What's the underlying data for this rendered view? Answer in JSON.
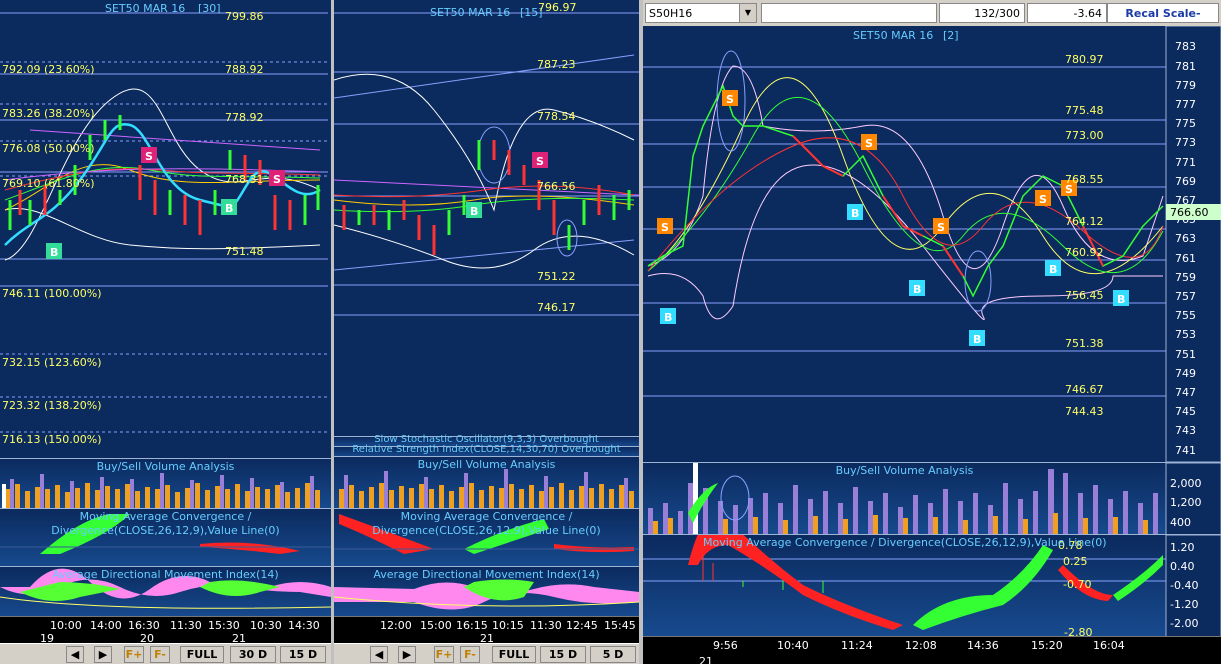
{
  "pane1": {
    "title": "SET50 MAR 16",
    "interval": "[30]",
    "fib": [
      "792.09 (23.60%)",
      "783.26 (38.20%)",
      "776.08 (50.00%)",
      "769.10 (61.80%)",
      "746.11 (100.00%)",
      "732.15 (123.60%)",
      "723.32 (138.20%)",
      "716.13 (150.00%)"
    ],
    "prices": [
      "799.86",
      "788.92",
      "778.92",
      "768.31",
      "751.48"
    ],
    "sub1": "Buy/Sell Volume Analysis",
    "sub2_line1": "Moving Average Convergence /",
    "sub2_line2": "Divergence(CLOSE,26,12,9),Value Line(0)",
    "sub3": "Average Directional Movement Index(14)",
    "times": [
      "10:00",
      "14:00",
      "16:30",
      "11:30",
      "15:30",
      "10:30",
      "14:30"
    ],
    "days": [
      "19",
      "20",
      "21"
    ],
    "tb": {
      "full": "FULL",
      "d30": "30 D",
      "d15": "15 D"
    }
  },
  "pane2": {
    "title": "SET50 MAR 16",
    "interval": "[15]",
    "prices": [
      "796.97",
      "787.23",
      "778.54",
      "766.56",
      "751.22",
      "746.17"
    ],
    "stoch": "Slow Stochastic Oscillator(9,3,3) Overbought",
    "rsi": "Relative Strength Index(CLOSE,14,30,70) Overbought",
    "sub1": "Buy/Sell Volume Analysis",
    "sub2_line1": "Moving Average Convergence /",
    "sub2_line2": "Divergence(CLOSE,26,12,9),Value Line(0)",
    "sub3": "Average Directional Movement Index(14)",
    "times": [
      "12:00",
      "15:00",
      "16:15",
      "10:15",
      "11:30",
      "12:45",
      "15:45"
    ],
    "days": [
      "21"
    ],
    "tb": {
      "full": "FULL",
      "d15": "15 D",
      "d5": "5 D"
    }
  },
  "pane3": {
    "symbol": "S50H16",
    "count": "132/300",
    "change": "-3.64",
    "recal": "Recal Scale-Linear",
    "title": "SET50 MAR 16",
    "interval": "[2]",
    "last": "766.60",
    "prices": [
      "780.97",
      "775.48",
      "773.00",
      "768.55",
      "764.12",
      "760.92",
      "756.45",
      "751.38",
      "746.67",
      "744.43"
    ],
    "axis": [
      "783",
      "781",
      "779",
      "777",
      "775",
      "773",
      "771",
      "769",
      "767",
      "765",
      "763",
      "761",
      "759",
      "757",
      "755",
      "753",
      "751",
      "749",
      "747",
      "745",
      "743",
      "741"
    ],
    "sub1": "Buy/Sell Volume Analysis",
    "vol_axis": [
      "2,000",
      "1,200",
      "400"
    ],
    "sub2": "Moving Average Convergence / Divergence(CLOSE,26,12,9),Value Line(0)",
    "macd_vals": [
      "0.78",
      "0.25",
      "-0.70"
    ],
    "macd_axis": [
      "1.20",
      "0.40",
      "-0.40",
      "-1.20",
      "-2.00"
    ],
    "bottom_val": "-2.80",
    "times": [
      "9:56",
      "10:40",
      "11:24",
      "12:08",
      "14:36",
      "15:20",
      "16:04"
    ],
    "day": "21"
  },
  "signals": {
    "buy": "B",
    "sell": "S"
  }
}
